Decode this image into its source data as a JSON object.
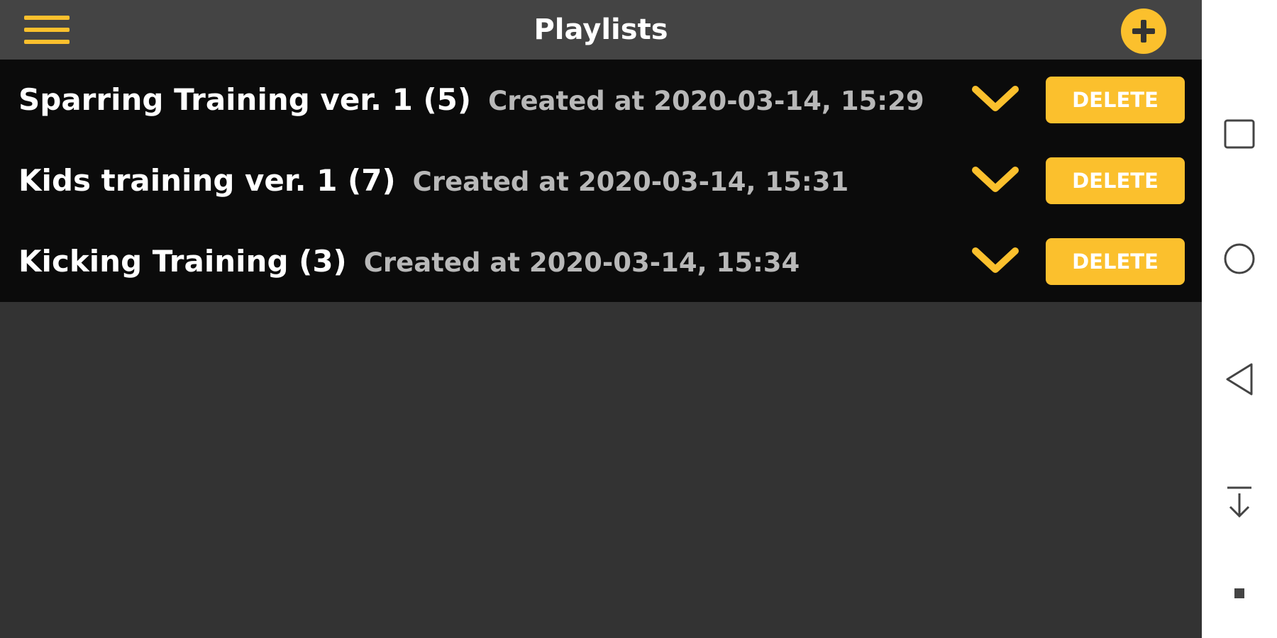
{
  "header": {
    "title": "Playlists",
    "menu_icon": "hamburger-menu-icon",
    "add_icon": "plus-circle-icon"
  },
  "playlists": [
    {
      "name": "Sparring Training ver. 1 (5)",
      "created": "Created at 2020-03-14, 15:29",
      "delete_label": "DELETE"
    },
    {
      "name": "Kids training ver. 1 (7)",
      "created": "Created at 2020-03-14, 15:31",
      "delete_label": "DELETE"
    },
    {
      "name": "Kicking Training (3)",
      "created": "Created at 2020-03-14, 15:34",
      "delete_label": "DELETE"
    }
  ],
  "row_icon": "chevron-down-icon",
  "system_nav": {
    "buttons": [
      "square-recents-icon",
      "circle-home-icon",
      "triangle-back-icon",
      "download-arrow-icon",
      "small-square-icon"
    ]
  },
  "colors": {
    "accent": "#fbc02d",
    "header_bg": "#444444",
    "list_bg": "#0b0b0b",
    "page_bg": "#333333",
    "date_text": "#b8b8b8"
  }
}
